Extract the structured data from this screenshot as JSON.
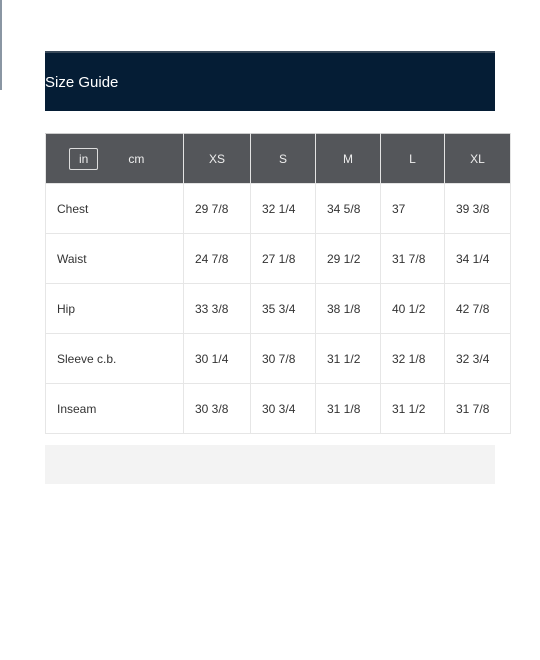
{
  "title": "Size Guide",
  "units": {
    "options": [
      "in",
      "cm"
    ],
    "selected": "in"
  },
  "sizes": [
    "XS",
    "S",
    "M",
    "L",
    "XL"
  ],
  "rows": [
    {
      "label": "Chest",
      "values": [
        "29 7/8",
        "32 1/4",
        "34 5/8",
        "37",
        "39 3/8"
      ]
    },
    {
      "label": "Waist",
      "values": [
        "24 7/8",
        "27 1/8",
        "29 1/2",
        "31 7/8",
        "34 1/4"
      ]
    },
    {
      "label": "Hip",
      "values": [
        "33 3/8",
        "35 3/4",
        "38 1/8",
        "40 1/2",
        "42 7/8"
      ]
    },
    {
      "label": "Sleeve c.b.",
      "values": [
        "30 1/4",
        "30 7/8",
        "31 1/2",
        "32 1/8",
        "32 3/4"
      ]
    },
    {
      "label": "Inseam",
      "values": [
        "30 3/8",
        "30 3/4",
        "31 1/8",
        "31 1/2",
        "31 7/8"
      ]
    }
  ]
}
